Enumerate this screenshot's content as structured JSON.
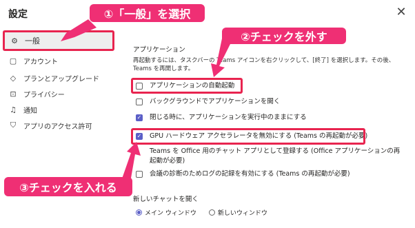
{
  "window": {
    "title": "設定",
    "close_icon": "close-icon"
  },
  "nav": {
    "items": [
      {
        "icon": "gear-icon",
        "label": "一般",
        "active": true
      },
      {
        "icon": "account-icon",
        "label": "アカウント"
      },
      {
        "icon": "diamond-icon",
        "label": "プランとアップグレード"
      },
      {
        "icon": "lock-icon",
        "label": "プライバシー"
      },
      {
        "icon": "bell-icon",
        "label": "通知"
      },
      {
        "icon": "shield-icon",
        "label": "アプリのアクセス許可"
      }
    ]
  },
  "annotations": {
    "step1": "①「一般」を選択",
    "step2": "②チェックを外す",
    "step3": "③チェックを入れる",
    "accent_color": "#ef2f74"
  },
  "main": {
    "section_label": "アプリケーション",
    "description": "再起動するには、タスクバーの Teams アイコンを右クリックして、[終了] を選択します。その後、Teams を再開します。",
    "options": [
      {
        "label": "アプリケーションの自動起動",
        "checked": false
      },
      {
        "label": "バックグラウンドでアプリケーションを開く",
        "checked": false
      },
      {
        "label": "閉じる時に、アプリケーションを実行中のままにする",
        "checked": true
      },
      {
        "label": "GPU ハードウェア アクセラレータを無効にする (Teams の再起動が必要)",
        "checked": true
      },
      {
        "label": "Teams を Office 用のチャット アプリとして登録する (Office アプリケーションの再起動が必要)",
        "checked": false
      },
      {
        "label": "会議の診断のためログの記録を有効にする (Teams の再起動が必要)",
        "checked": false
      }
    ],
    "new_chat": {
      "label": "新しいチャットを開く",
      "options": [
        {
          "label": "メイン ウィンドウ",
          "selected": true
        },
        {
          "label": "新しいウィンドウ",
          "selected": false
        }
      ]
    }
  }
}
